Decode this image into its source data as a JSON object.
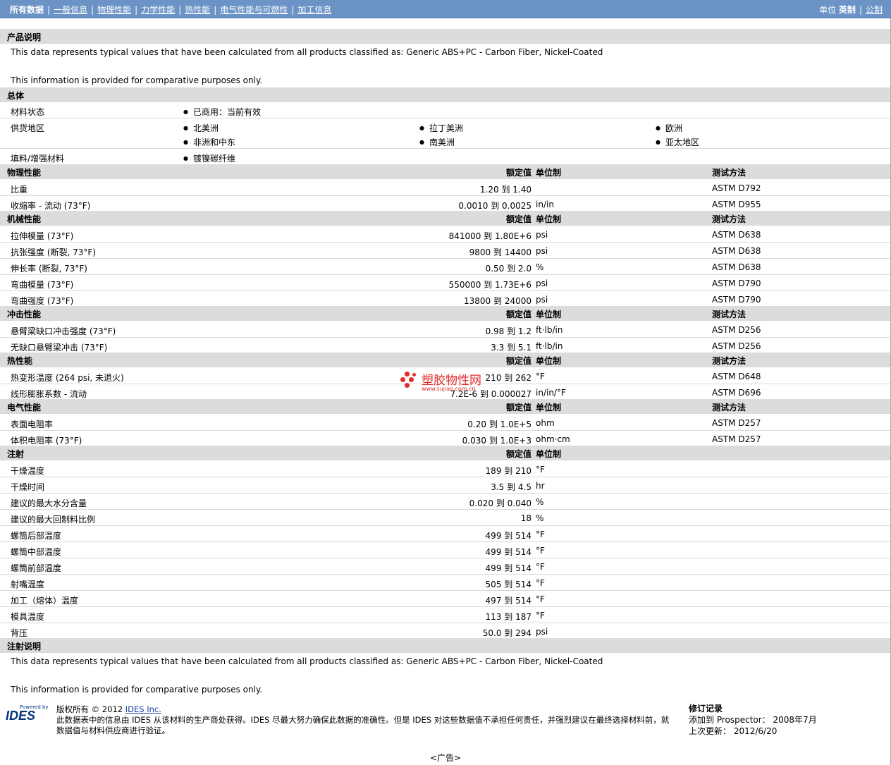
{
  "nav": {
    "tabs": [
      "所有数据",
      "一般信息",
      "物理性能",
      "力学性能",
      "热性能",
      "电气性能与可燃性",
      "加工信息"
    ],
    "unit_label": "单位",
    "unit_english": "英制",
    "unit_metric": "公制"
  },
  "product": {
    "title": "产品说明",
    "line1": "This data represents typical values that have been calculated from all products classified as: Generic ABS+PC - Carbon Fiber, Nickel-Coated",
    "line2": "This information is provided for comparative purposes only."
  },
  "general": {
    "title": "总体",
    "status_label": "材料状态",
    "status_value": "已商用：当前有效",
    "region_label": "供货地区",
    "regions": [
      "北美洲",
      "拉丁美洲",
      "欧洲",
      "非洲和中东",
      "南美洲",
      "亚太地区"
    ],
    "filler_label": "填料/增强材料",
    "filler_value": "镀镍碳纤维"
  },
  "headers": {
    "nominal": "额定值",
    "unit": "单位制",
    "method": "测试方法"
  },
  "physical": {
    "title": "物理性能",
    "rows": [
      {
        "label": "比重",
        "value": "1.20 到  1.40",
        "unit": "",
        "method": "ASTM D792"
      },
      {
        "label": "收缩率  - 流动  (73°F)",
        "value": "0.0010 到  0.0025",
        "unit": "in/in",
        "method": "ASTM D955"
      }
    ]
  },
  "mechanical": {
    "title": "机械性能",
    "rows": [
      {
        "label": "拉伸模量  (73°F)",
        "value": "841000 到  1.80E+6",
        "unit": "psi",
        "method": "ASTM D638"
      },
      {
        "label": "抗张强度  (断裂, 73°F)",
        "value": "9800 到  14400",
        "unit": "psi",
        "method": "ASTM D638"
      },
      {
        "label": "伸长率  (断裂, 73°F)",
        "value": "0.50 到  2.0",
        "unit": "%",
        "method": "ASTM D638"
      },
      {
        "label": "弯曲模量  (73°F)",
        "value": "550000 到  1.73E+6",
        "unit": "psi",
        "method": "ASTM D790"
      },
      {
        "label": "弯曲强度  (73°F)",
        "value": "13800 到  24000",
        "unit": "psi",
        "method": "ASTM D790"
      }
    ]
  },
  "impact": {
    "title": "冲击性能",
    "rows": [
      {
        "label": "悬臂梁缺口冲击强度  (73°F)",
        "value": "0.98 到  1.2",
        "unit": "ft·lb/in",
        "method": "ASTM D256"
      },
      {
        "label": "无缺口悬臂梁冲击  (73°F)",
        "value": "3.3 到  5.1",
        "unit": "ft·lb/in",
        "method": "ASTM D256"
      }
    ]
  },
  "thermal": {
    "title": "热性能",
    "rows": [
      {
        "label": "热变形温度  (264 psi, 未退火)",
        "value": "210 到  262",
        "unit": "°F",
        "method": "ASTM D648"
      },
      {
        "label": "线形膨胀系数  - 流动",
        "value": "7.2E-6 到  0.000027",
        "unit": "in/in/°F",
        "method": "ASTM D696"
      }
    ]
  },
  "electrical": {
    "title": "电气性能",
    "rows": [
      {
        "label": "表面电阻率",
        "value": "0.20 到  1.0E+5",
        "unit": "ohm",
        "method": "ASTM D257"
      },
      {
        "label": "体积电阻率  (73°F)",
        "value": "0.030 到  1.0E+3",
        "unit": "ohm·cm",
        "method": "ASTM D257"
      }
    ]
  },
  "injection": {
    "title": "注射",
    "rows": [
      {
        "label": "干燥温度",
        "value": "189 到  210",
        "unit": "°F"
      },
      {
        "label": "干燥时间",
        "value": "3.5 到  4.5",
        "unit": "hr"
      },
      {
        "label": "建议的最大水分含量",
        "value": "0.020 到  0.040",
        "unit": "%"
      },
      {
        "label": "建议的最大回制料比例",
        "value": "18",
        "unit": "%"
      },
      {
        "label": "螺筒后部温度",
        "value": "499 到  514",
        "unit": "°F"
      },
      {
        "label": "螺筒中部温度",
        "value": "499 到  514",
        "unit": "°F"
      },
      {
        "label": "螺筒前部温度",
        "value": "499 到  514",
        "unit": "°F"
      },
      {
        "label": "射嘴温度",
        "value": "505 到  514",
        "unit": "°F"
      },
      {
        "label": "加工（熔体）温度",
        "value": "497 到  514",
        "unit": "°F"
      },
      {
        "label": "模具温度",
        "value": "113 到  187",
        "unit": "°F"
      },
      {
        "label": "背压",
        "value": "50.0 到  294",
        "unit": "psi"
      }
    ]
  },
  "injection_notes": {
    "title": "注射说明",
    "line1": "This data represents typical values that have been calculated from all products classified as: Generic ABS+PC - Carbon Fiber, Nickel-Coated",
    "line2": "This information is provided for comparative purposes only."
  },
  "footer": {
    "logo_powered": "Powered by",
    "logo_name": "IDES",
    "copyright": "版权所有  © 2012 ",
    "company_link": "IDES Inc.",
    "disclaimer": "此数据表中的信息由  IDES 从该材料的生产商处获得。IDES 尽最大努力确保此数据的准确性。但是  IDES 对这些数据值不承担任何责任，并强烈建议在最终选择材料前，就数据值与材料供应商进行验证。",
    "revision_title": "修订记录",
    "added_label": "添加到  Prospector：",
    "added_value": "2008年7月",
    "updated_label": "上次更新：",
    "updated_value": "2012/6/20",
    "ad": "<广告>"
  },
  "watermark": {
    "name": "塑胶物性网",
    "url": "www.sujiao.com.cn"
  },
  "colors": {
    "nav_bg": "#6b93c6",
    "section_bg": "#dcdcdc",
    "watermark": "#e52a2a"
  }
}
